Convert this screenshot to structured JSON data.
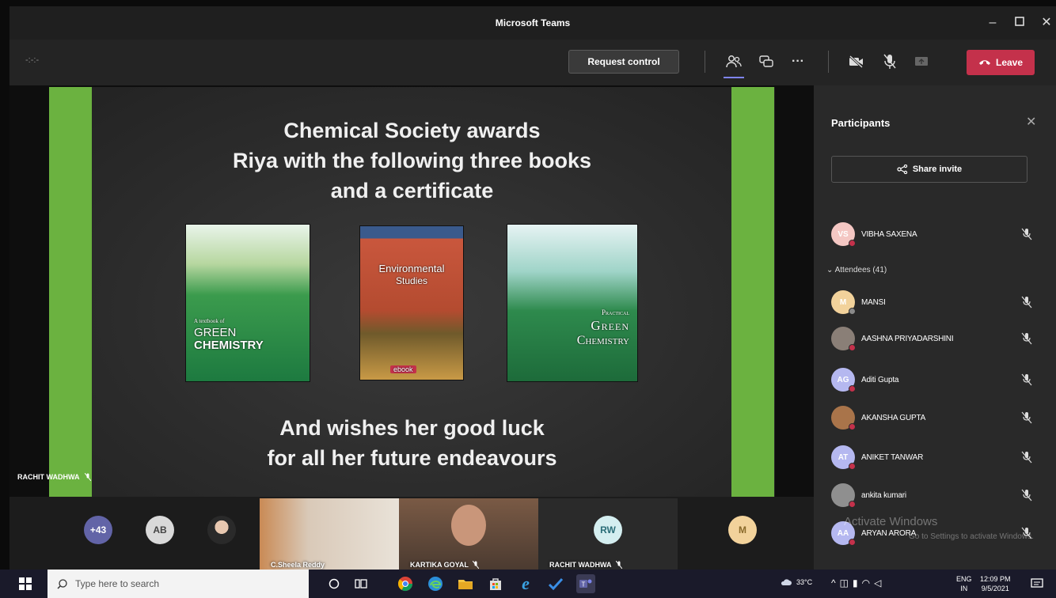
{
  "window": {
    "title": "Microsoft Teams"
  },
  "toolbar": {
    "timer": "-:-:-",
    "request_control": "Request control",
    "leave": "Leave"
  },
  "slide": {
    "title_lines": [
      "Chemical Society awards",
      "Riya with the following three books",
      "and a certificate"
    ],
    "footer_lines": [
      "And wishes her good luck",
      "for all her future endeavours"
    ],
    "books": [
      {
        "title_line1": "GREEN",
        "title_line2": "CHEMISTRY",
        "subtitle": "A textbook of"
      },
      {
        "title_line1": "Environmental",
        "title_line2": "Studies",
        "badge": "ebook"
      },
      {
        "title_line1": "Practical",
        "title_line2": "Green",
        "title_line3": "Chemistry"
      }
    ],
    "presenter": "RACHIT WADHWA"
  },
  "panel": {
    "title": "Participants",
    "share_invite": "Share invite",
    "organizer": {
      "initials": "VS",
      "name": "VIBHA SAXENA"
    },
    "attendees_label": "Attendees (41)",
    "attendees": [
      {
        "initials": "M",
        "name": "MANSI",
        "color": "#f2d29b"
      },
      {
        "initials": "",
        "name": "AASHNA PRIYADARSHINI",
        "color": "#8a7f77"
      },
      {
        "initials": "AG",
        "name": "Aditi Gupta",
        "color": "#b5b8f0"
      },
      {
        "initials": "",
        "name": "AKANSHA GUPTA",
        "color": "#a9744a"
      },
      {
        "initials": "AT",
        "name": "ANIKET TANWAR",
        "color": "#b5b8f0"
      },
      {
        "initials": "",
        "name": "ankita kumari",
        "color": "#8f8f8f"
      },
      {
        "initials": "AA",
        "name": "ARYAN ARORA",
        "color": "#b5b8f0"
      }
    ],
    "watermark_title": "Activate Windows",
    "watermark_sub": "Go to Settings to activate Windows."
  },
  "gallery": {
    "overflow_count": "+43",
    "circle_ab": "AB",
    "tile1_name": "C.Sheela Reddy",
    "tile2_name": "KARTIKA GOYAL",
    "rw_initials": "RW",
    "rw_name": "RACHIT WADHWA",
    "m_initials": "M"
  },
  "taskbar": {
    "search_placeholder": "Type here to search",
    "temperature": "33°C",
    "lang_top": "ENG",
    "lang_bottom": "IN",
    "time": "12:09 PM",
    "date": "9/5/2021"
  },
  "colors": {
    "leave": "#c4314b",
    "stripe_green": "#6bb240",
    "accent": "#7f85f5"
  }
}
